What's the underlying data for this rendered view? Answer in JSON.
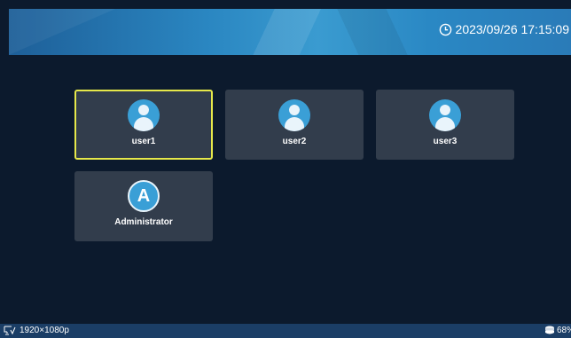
{
  "header": {
    "datetime": "2023/09/26 17:15:09",
    "clock_icon": "clock-icon"
  },
  "users": [
    {
      "label": "user1",
      "selected": true,
      "avatar": "user-avatar-icon"
    },
    {
      "label": "user2",
      "selected": false,
      "avatar": "user-avatar-icon"
    },
    {
      "label": "user3",
      "selected": false,
      "avatar": "user-avatar-icon"
    },
    {
      "label": "Administrator",
      "selected": false,
      "avatar": "admin-avatar-icon",
      "avatar_letter": "A"
    }
  ],
  "footer": {
    "resolution": "1920×1080p",
    "resolution_icon": "display-icon",
    "storage": "68%",
    "storage_icon": "storage-icon"
  },
  "colors": {
    "background": "#0c1a2d",
    "tile": "#323d4c",
    "selected_border": "#e6e84a",
    "avatar": "#3a9fd6",
    "footer": "#1b3e66"
  }
}
